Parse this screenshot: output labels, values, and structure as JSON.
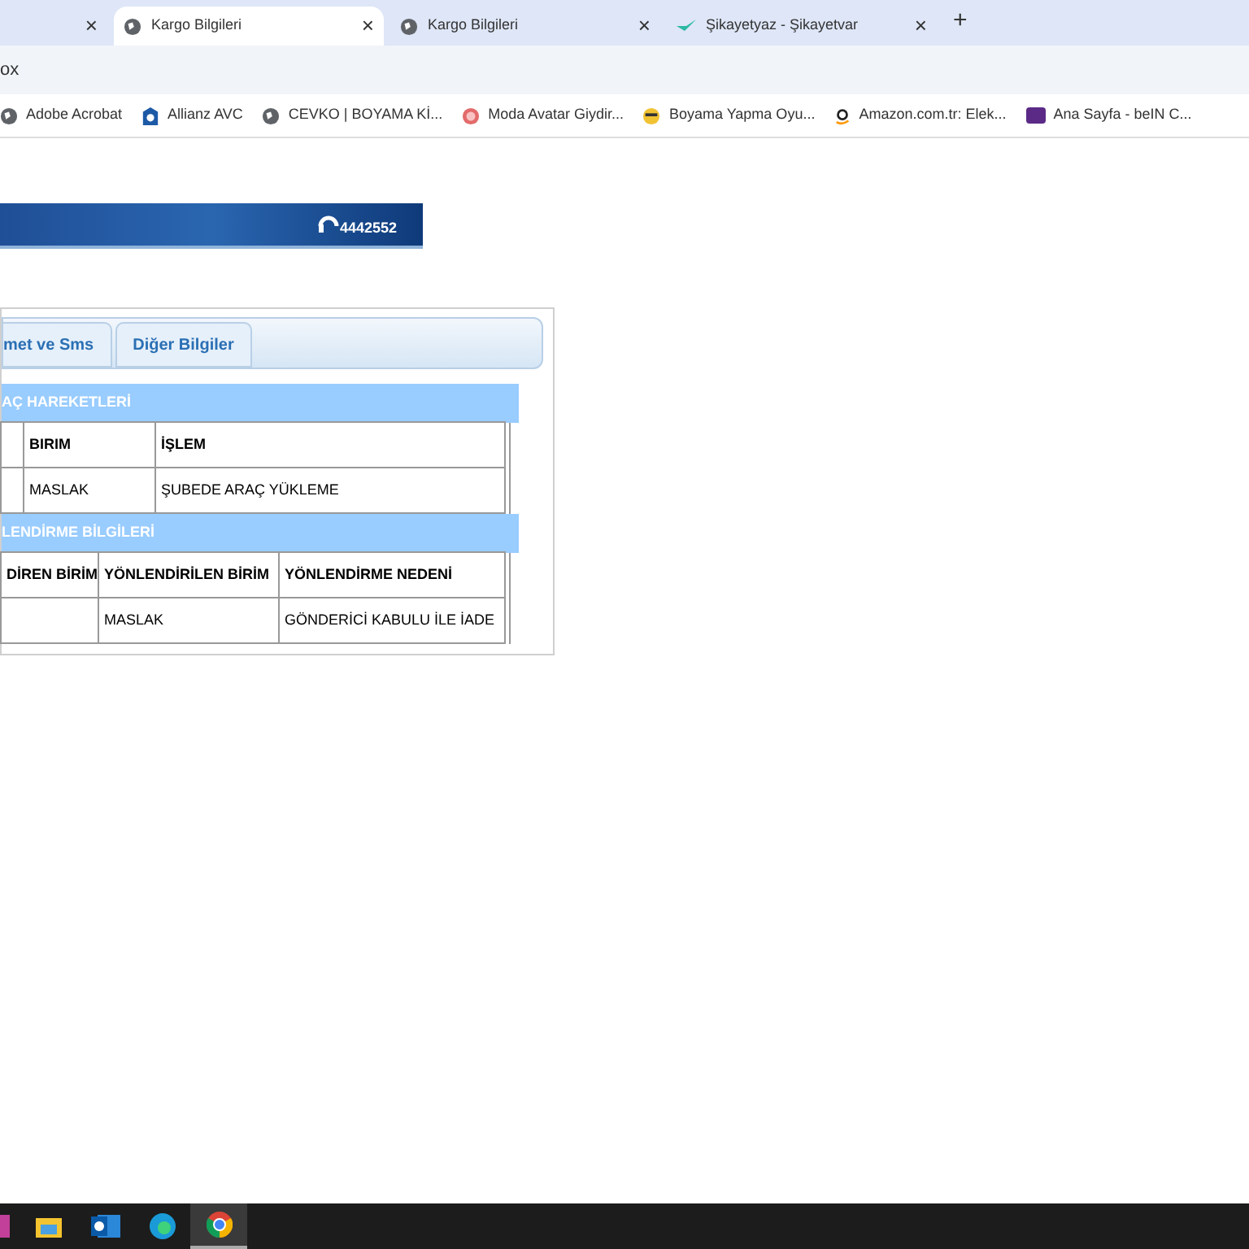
{
  "browser_tabs": [
    {
      "selected": false,
      "kind": "bare"
    },
    {
      "title": "Kargo Bilgileri",
      "selected": true,
      "kind": "globe"
    },
    {
      "title": "Kargo Bilgileri",
      "selected": false,
      "kind": "globe"
    },
    {
      "title": "Şikayetyaz - Şikayetvar",
      "selected": false,
      "kind": "bird"
    }
  ],
  "new_tab": "+",
  "close_glyph": "×",
  "address": "ox",
  "bookmarks": [
    {
      "label": "Adobe Acrobat",
      "kind": "globe"
    },
    {
      "label": "Allianz AVC",
      "kind": "shield"
    },
    {
      "label": "CEVKO | BOYAMA Kİ...",
      "kind": "globe"
    },
    {
      "label": "Moda Avatar Giydir...",
      "kind": "circle"
    },
    {
      "label": "Boyama Yapma Oyu...",
      "kind": "face"
    },
    {
      "label": "Amazon.com.tr: Elek...",
      "kind": "amazon"
    },
    {
      "label": "Ana Sayfa - beIN C...",
      "kind": "tv"
    }
  ],
  "banner": {
    "phone": "4442552"
  },
  "page_tabs": [
    {
      "label": "met ve Sms",
      "selected": false
    },
    {
      "label": "Diğer Bilgiler",
      "selected": false
    }
  ],
  "sections": [
    {
      "title": "AÇ HAREKETLERİ",
      "columns": [
        "",
        "BIRIM",
        "İŞLEM"
      ],
      "rows": [
        [
          "",
          "MASLAK",
          "ŞUBEDE ARAÇ YÜKLEME"
        ]
      ]
    },
    {
      "title": "LENDİRME BİLGİLERİ",
      "columns": [
        "DİREN BİRİM",
        "YÖNLENDİRİLEN BİRİM",
        "YÖNLENDİRME NEDENİ"
      ],
      "rows": [
        [
          "",
          "MASLAK",
          "GÖNDERİCİ KABULU İLE İADE"
        ]
      ]
    }
  ],
  "taskbar": [
    {
      "kind": "partial",
      "active": false
    },
    {
      "kind": "folder",
      "active": false
    },
    {
      "kind": "mail",
      "active": false
    },
    {
      "kind": "edge",
      "active": false
    },
    {
      "kind": "chrome",
      "active": true
    }
  ]
}
